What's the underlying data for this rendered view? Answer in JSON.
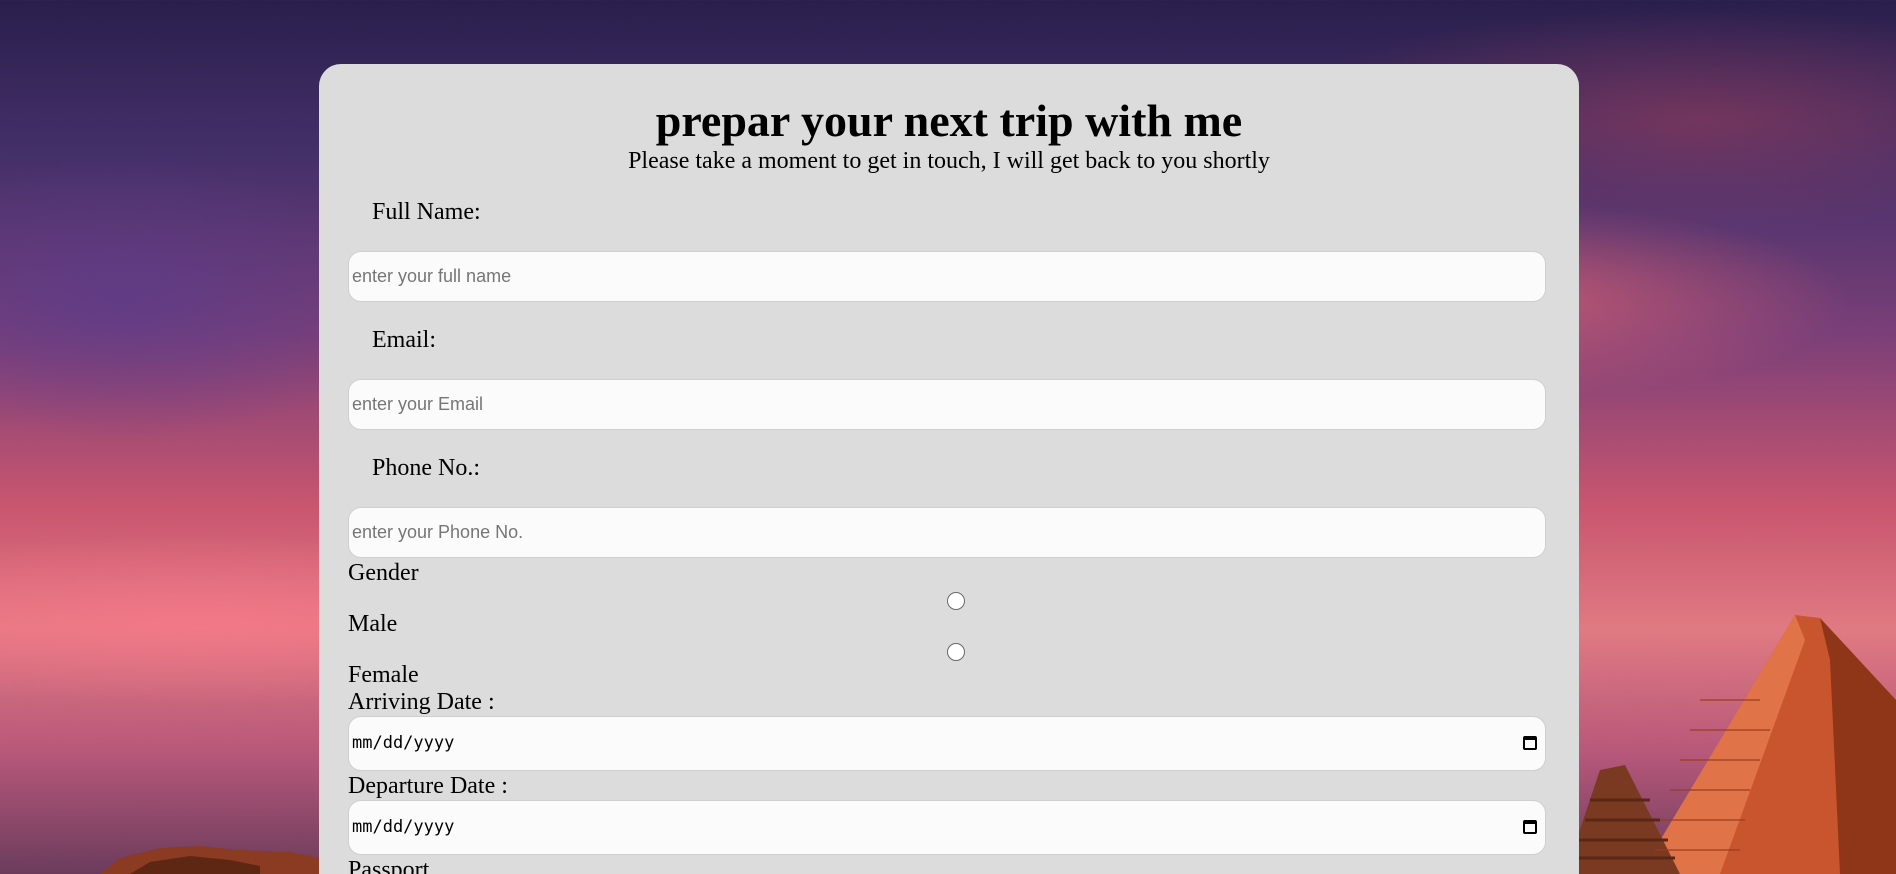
{
  "colors": {
    "card_background": "#dcdcdc",
    "input_background": "#fbfbfb",
    "input_border": "#cfcfcf",
    "text": "#000000",
    "placeholder": "#767676"
  },
  "form": {
    "title": "prepar your next trip with me",
    "subtitle": "Please take a moment to get in touch, I will get back to you shortly",
    "full_name": {
      "label": "Full Name:",
      "placeholder": "enter your full name"
    },
    "email": {
      "label": "Email:",
      "placeholder": "enter your Email"
    },
    "phone": {
      "label": "Phone No.:",
      "placeholder": "enter your Phone No."
    },
    "gender": {
      "label": "Gender",
      "options": [
        "Male",
        "Female"
      ]
    },
    "arriving_date": {
      "label": "Arriving Date :",
      "value_format": "mm/dd/yyyy",
      "icon": "calendar-icon"
    },
    "departure_date": {
      "label": "Departure Date :",
      "value_format": "mm/dd/yyyy",
      "icon": "calendar-icon"
    },
    "passport": {
      "label": "Passport"
    }
  }
}
